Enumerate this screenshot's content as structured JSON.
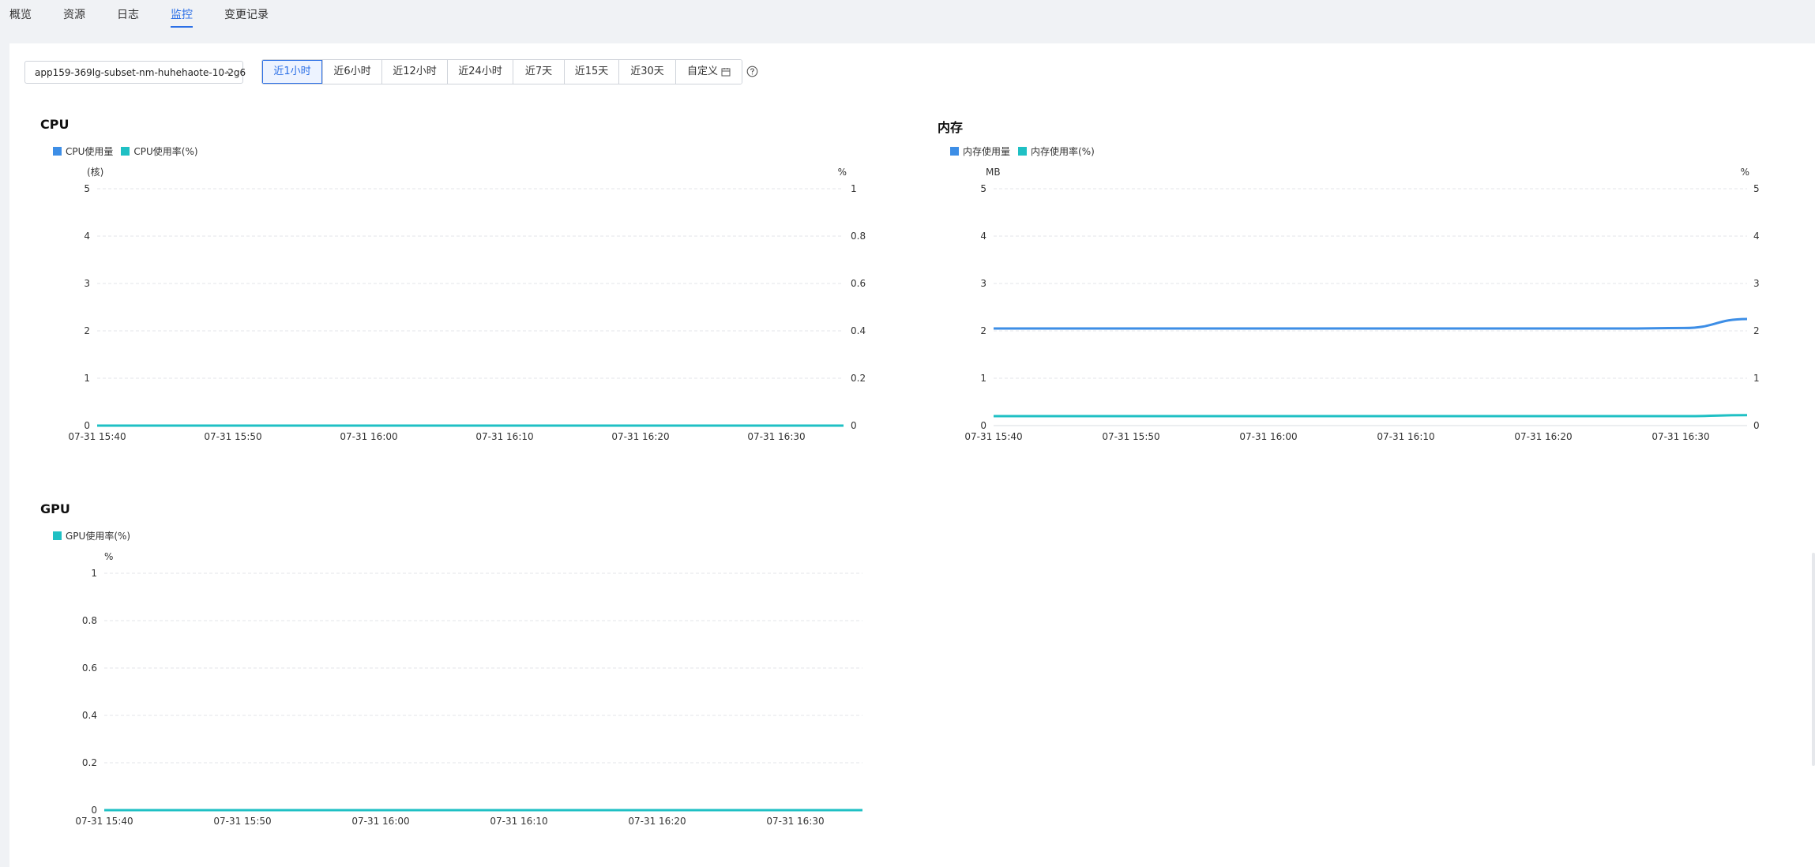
{
  "tabs": [
    {
      "label": "概览",
      "active": false
    },
    {
      "label": "资源",
      "active": false
    },
    {
      "label": "日志",
      "active": false
    },
    {
      "label": "监控",
      "active": true
    },
    {
      "label": "变更记录",
      "active": false
    }
  ],
  "toolbar": {
    "instance_value": "app159-369lg-subset-nm-huhehaote-10-2g6",
    "ranges": [
      {
        "label": "近1小时",
        "active": true
      },
      {
        "label": "近6小时",
        "active": false
      },
      {
        "label": "近12小时",
        "active": false
      },
      {
        "label": "近24小时",
        "active": false
      },
      {
        "label": "近7天",
        "active": false
      },
      {
        "label": "近15天",
        "active": false
      },
      {
        "label": "近30天",
        "active": false
      },
      {
        "label": "自定义",
        "active": false,
        "icon": "calendar-icon"
      }
    ],
    "help_icon": "question-circle-icon"
  },
  "colors": {
    "accent": "#2b6fe6",
    "series_blue": "#3d8ee6",
    "series_teal": "#1fc0c4",
    "grid": "#e6e8ec"
  },
  "chart_data": [
    {
      "type": "line",
      "title": "CPU",
      "legend": [
        "CPU使用量",
        "CPU使用率(%)"
      ],
      "y_left_label": "(核)",
      "y_right_label": "%",
      "ylim_left": [
        0,
        5
      ],
      "ylim_right": [
        0,
        1
      ],
      "y_left_ticks": [
        "5",
        "4",
        "3",
        "2",
        "1",
        "0"
      ],
      "y_right_ticks": [
        "1",
        "0.8",
        "0.6",
        "0.4",
        "0.2",
        "0"
      ],
      "x_ticks": [
        "07-31 15:40",
        "07-31 15:50",
        "07-31 16:00",
        "07-31 16:10",
        "07-31 16:20",
        "07-31 16:30"
      ],
      "series": [
        {
          "name": "CPU使用量",
          "axis": "left",
          "color": "#3d8ee6",
          "x": [
            "15:40",
            "15:50",
            "16:00",
            "16:10",
            "16:20",
            "16:30",
            "16:40"
          ],
          "values": [
            0,
            0,
            0,
            0,
            0,
            0,
            0
          ]
        },
        {
          "name": "CPU使用率(%)",
          "axis": "right",
          "color": "#1fc0c4",
          "x": [
            "15:40",
            "15:50",
            "16:00",
            "16:10",
            "16:20",
            "16:30",
            "16:40"
          ],
          "values": [
            0,
            0,
            0,
            0,
            0,
            0,
            0
          ]
        }
      ]
    },
    {
      "type": "line",
      "title": "内存",
      "legend": [
        "内存使用量",
        "内存使用率(%)"
      ],
      "y_left_label": "MB",
      "y_right_label": "%",
      "ylim_left": [
        0,
        5
      ],
      "ylim_right": [
        0,
        5
      ],
      "y_left_ticks": [
        "5",
        "4",
        "3",
        "2",
        "1",
        "0"
      ],
      "y_right_ticks": [
        "5",
        "4",
        "3",
        "2",
        "1",
        "0"
      ],
      "x_ticks": [
        "07-31 15:40",
        "07-31 15:50",
        "07-31 16:00",
        "07-31 16:10",
        "07-31 16:20",
        "07-31 16:30"
      ],
      "series": [
        {
          "name": "内存使用量",
          "axis": "left",
          "color": "#3d8ee6",
          "x": [
            "15:40",
            "15:50",
            "16:00",
            "16:10",
            "16:20",
            "16:30",
            "16:35",
            "16:40"
          ],
          "values": [
            2.05,
            2.05,
            2.05,
            2.05,
            2.05,
            2.05,
            2.06,
            2.25
          ]
        },
        {
          "name": "内存使用率(%)",
          "axis": "right",
          "color": "#1fc0c4",
          "x": [
            "15:40",
            "15:50",
            "16:00",
            "16:10",
            "16:20",
            "16:30",
            "16:35",
            "16:40"
          ],
          "values": [
            0.2,
            0.2,
            0.2,
            0.2,
            0.2,
            0.2,
            0.2,
            0.22
          ]
        }
      ]
    },
    {
      "type": "line",
      "title": "GPU",
      "legend": [
        "GPU使用率(%)"
      ],
      "y_left_label": "%",
      "ylim_left": [
        0,
        1
      ],
      "y_left_ticks": [
        "1",
        "0.8",
        "0.6",
        "0.4",
        "0.2",
        "0"
      ],
      "x_ticks": [
        "07-31 15:40",
        "07-31 15:50",
        "07-31 16:00",
        "07-31 16:10",
        "07-31 16:20",
        "07-31 16:30"
      ],
      "series": [
        {
          "name": "GPU使用率(%)",
          "axis": "left",
          "color": "#1fc0c4",
          "x": [
            "15:40",
            "15:50",
            "16:00",
            "16:10",
            "16:20",
            "16:30",
            "16:40"
          ],
          "values": [
            0,
            0,
            0,
            0,
            0,
            0,
            0
          ]
        }
      ]
    }
  ]
}
